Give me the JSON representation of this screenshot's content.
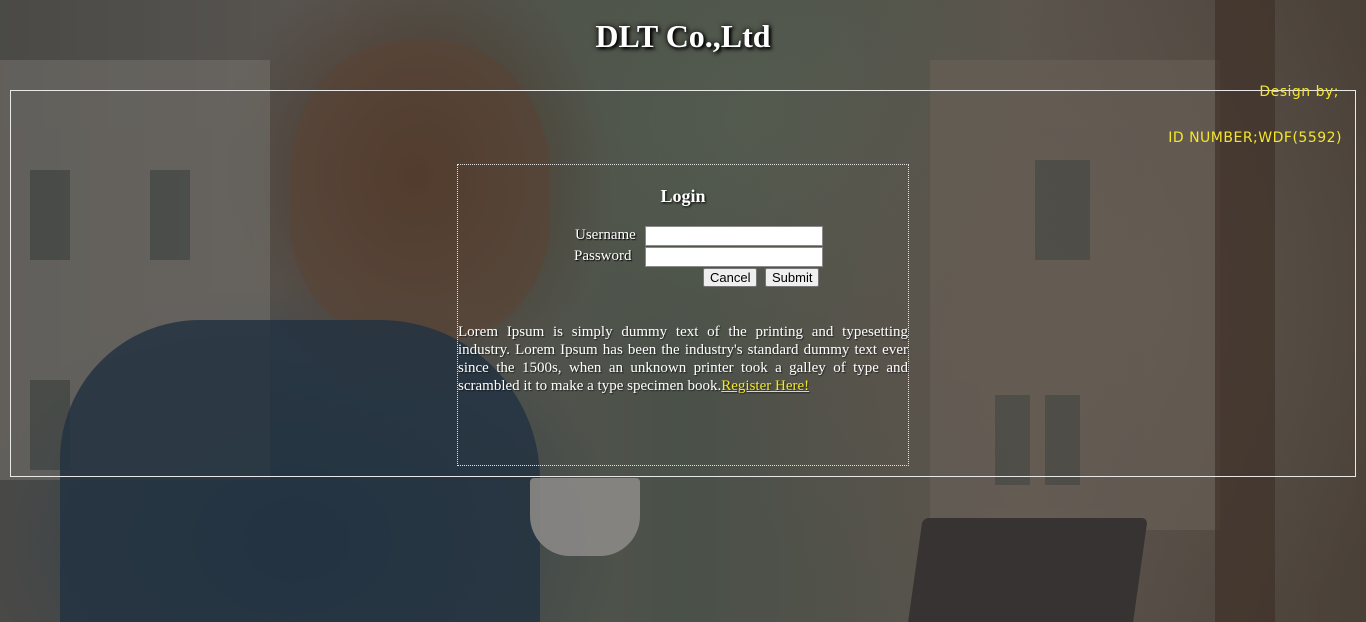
{
  "header": {
    "title": "DLT Co.,Ltd"
  },
  "credits": {
    "design_by": "Design by;",
    "id_number": "ID NUMBER;WDF(5592)"
  },
  "login": {
    "heading": "Login",
    "username_label": "Username",
    "username_value": "",
    "password_label": "Password",
    "password_value": "",
    "cancel_label": "Cancel",
    "submit_label": "Submit"
  },
  "intro": {
    "text": "Lorem Ipsum is simply dummy text of the printing and typesetting industry. Lorem Ipsum has been the industry's standard dummy text ever since the 1500s, when an unknown printer took a galley of type and scrambled it to make a type specimen book.",
    "register_link": "Register Here!"
  },
  "colors": {
    "accent_yellow": "#f4e62a",
    "text": "#ffffff",
    "frame_border": "#e8e8e8"
  }
}
